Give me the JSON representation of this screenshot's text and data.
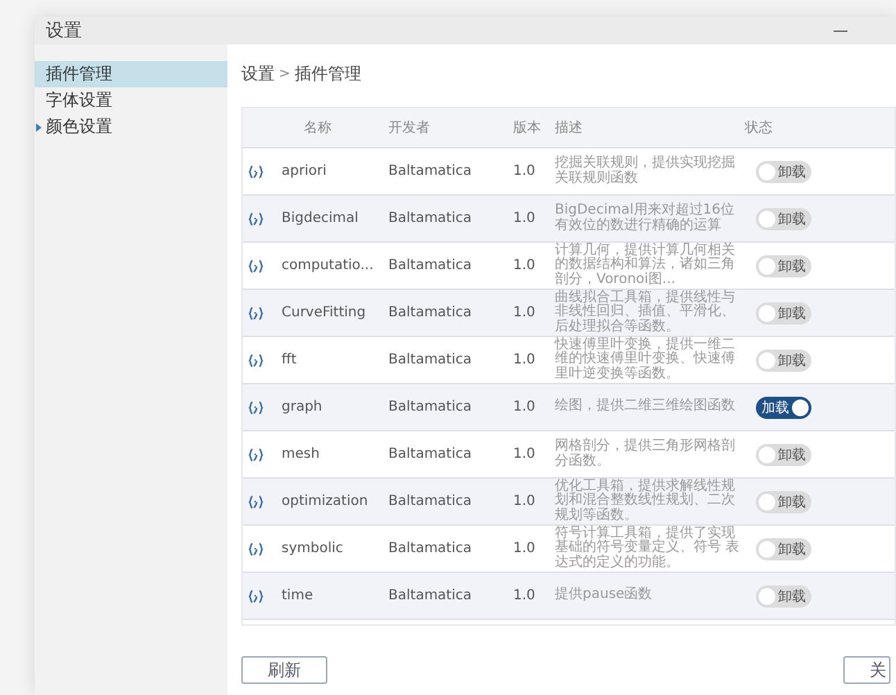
{
  "window": {
    "title": "设置"
  },
  "sidebar": {
    "items": [
      {
        "label": "插件管理",
        "selected": true
      },
      {
        "label": "字体设置",
        "selected": false
      },
      {
        "label": "颜色设置",
        "selected": false,
        "expanded": false
      }
    ]
  },
  "breadcrumb": [
    "设置",
    "插件管理"
  ],
  "breadcrumb_separator": ">",
  "table": {
    "columns": [
      "名称",
      "开发者",
      "版本",
      "描述",
      "状态"
    ],
    "rows": [
      {
        "name": "apriori",
        "developer": "Baltamatica",
        "version": "1.0",
        "description": "挖掘关联规则，提供实现挖掘关联规则函数",
        "loaded": false,
        "toggle_label": "卸载"
      },
      {
        "name": "Bigdecimal",
        "developer": "Baltamatica",
        "version": "1.0",
        "description": "BigDecimal用来对超过16位有效位的数进行精确的运算",
        "loaded": false,
        "toggle_label": "卸载"
      },
      {
        "name": "computatio...",
        "developer": "Baltamatica",
        "version": "1.0",
        "description": "计算几何，提供计算几何相关的数据结构和算法，诸如三角剖分，Voronoi图...",
        "loaded": false,
        "toggle_label": "卸载"
      },
      {
        "name": "CurveFitting",
        "developer": "Baltamatica",
        "version": "1.0",
        "description": "曲线拟合工具箱，提供线性与非线性回归、插值、平滑化、后处理拟合等函数。",
        "loaded": false,
        "toggle_label": "卸载"
      },
      {
        "name": "fft",
        "developer": "Baltamatica",
        "version": "1.0",
        "description": "快速傅里叶变换，提供一维二维的快速傅里叶变换、快速傅里叶逆变换等函数。",
        "loaded": false,
        "toggle_label": "卸载"
      },
      {
        "name": "graph",
        "developer": "Baltamatica",
        "version": "1.0",
        "description": "绘图，提供二维三维绘图函数",
        "loaded": true,
        "toggle_label": "加载"
      },
      {
        "name": "mesh",
        "developer": "Baltamatica",
        "version": "1.0",
        "description": "网格剖分，提供三角形网格剖分函数。",
        "loaded": false,
        "toggle_label": "卸载"
      },
      {
        "name": "optimization",
        "developer": "Baltamatica",
        "version": "1.0",
        "description": "优化工具箱，提供求解线性规划和混合整数线性规划、二次规划等函数。",
        "loaded": false,
        "toggle_label": "卸载"
      },
      {
        "name": "symbolic",
        "developer": "Baltamatica",
        "version": "1.0",
        "description": "符号计算工具箱，提供了实现基础的符号变量定义、符号 表达式的定义的功能。",
        "loaded": false,
        "toggle_label": "卸载"
      },
      {
        "name": "time",
        "developer": "Baltamatica",
        "version": "1.0",
        "description": "提供pause函数",
        "loaded": false,
        "toggle_label": "卸载"
      }
    ]
  },
  "buttons": [
    "刷新",
    "关"
  ]
}
